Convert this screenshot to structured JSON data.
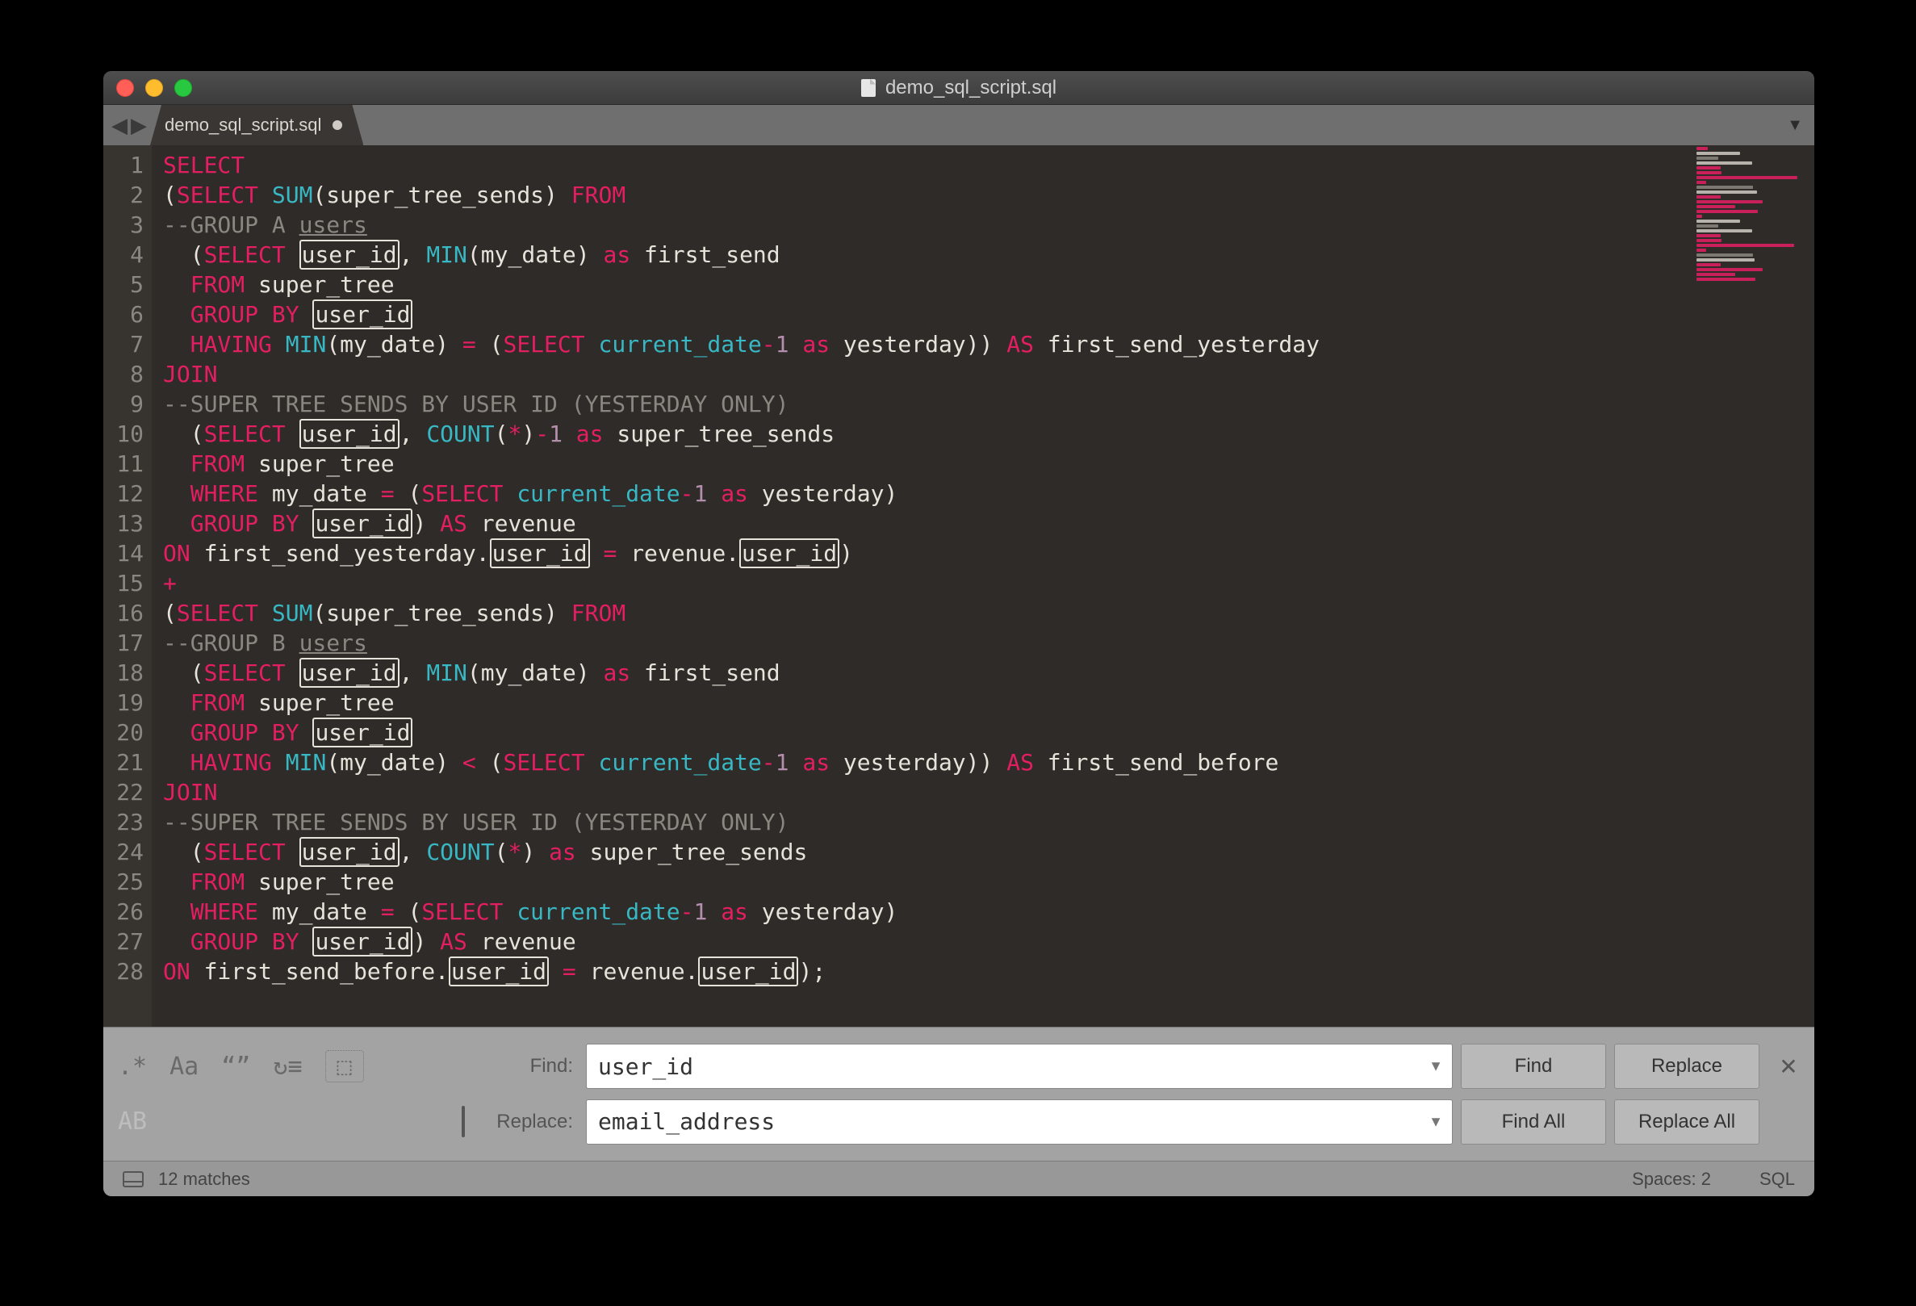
{
  "window": {
    "title": "demo_sql_script.sql"
  },
  "tabs": {
    "active": {
      "label": "demo_sql_script.sql",
      "dirty": true
    }
  },
  "code_lines": [
    [
      {
        "t": "SELECT",
        "c": "kw"
      }
    ],
    [
      {
        "t": "(",
        "c": "al"
      },
      {
        "t": "SELECT ",
        "c": "kw"
      },
      {
        "t": "SUM",
        "c": "fn"
      },
      {
        "t": "(super_tree_sends) ",
        "c": "al"
      },
      {
        "t": "FROM",
        "c": "kw"
      }
    ],
    [
      {
        "t": "--GROUP A ",
        "c": "cm"
      },
      {
        "t": "users",
        "c": "cm",
        "u": true
      }
    ],
    [
      {
        "t": "  (",
        "c": "al"
      },
      {
        "t": "SELECT ",
        "c": "kw"
      },
      {
        "t": "user_id",
        "c": "al",
        "hl": true
      },
      {
        "t": ", ",
        "c": "al"
      },
      {
        "t": "MIN",
        "c": "fn"
      },
      {
        "t": "(my_date) ",
        "c": "al"
      },
      {
        "t": "as",
        "c": "as"
      },
      {
        "t": " first_send",
        "c": "al"
      }
    ],
    [
      {
        "t": "  ",
        "c": "al"
      },
      {
        "t": "FROM",
        "c": "kw"
      },
      {
        "t": " super_tree",
        "c": "al"
      }
    ],
    [
      {
        "t": "  ",
        "c": "al"
      },
      {
        "t": "GROUP BY ",
        "c": "kw"
      },
      {
        "t": "user_id",
        "c": "al",
        "hl": true
      }
    ],
    [
      {
        "t": "  ",
        "c": "al"
      },
      {
        "t": "HAVING ",
        "c": "kw"
      },
      {
        "t": "MIN",
        "c": "fn"
      },
      {
        "t": "(my_date) ",
        "c": "al"
      },
      {
        "t": "= ",
        "c": "kw"
      },
      {
        "t": "(",
        "c": "al"
      },
      {
        "t": "SELECT ",
        "c": "kw"
      },
      {
        "t": "current_date",
        "c": "fn"
      },
      {
        "t": "-",
        "c": "kw"
      },
      {
        "t": "1",
        "c": "num"
      },
      {
        "t": " ",
        "c": "al"
      },
      {
        "t": "as",
        "c": "as"
      },
      {
        "t": " yesterday)) ",
        "c": "al"
      },
      {
        "t": "AS",
        "c": "kw"
      },
      {
        "t": " first_send_yesterday",
        "c": "al"
      }
    ],
    [
      {
        "t": "JOIN",
        "c": "kw"
      }
    ],
    [
      {
        "t": "--SUPER TREE SENDS BY USER ID (YESTERDAY ONLY)",
        "c": "cm"
      }
    ],
    [
      {
        "t": "  (",
        "c": "al"
      },
      {
        "t": "SELECT ",
        "c": "kw"
      },
      {
        "t": "user_id",
        "c": "al",
        "hl": true
      },
      {
        "t": ", ",
        "c": "al"
      },
      {
        "t": "COUNT",
        "c": "fn"
      },
      {
        "t": "(",
        "c": "al"
      },
      {
        "t": "*",
        "c": "kw"
      },
      {
        "t": ")",
        "c": "al"
      },
      {
        "t": "-",
        "c": "kw"
      },
      {
        "t": "1",
        "c": "num"
      },
      {
        "t": " ",
        "c": "al"
      },
      {
        "t": "as",
        "c": "as"
      },
      {
        "t": " super_tree_sends",
        "c": "al"
      }
    ],
    [
      {
        "t": "  ",
        "c": "al"
      },
      {
        "t": "FROM",
        "c": "kw"
      },
      {
        "t": " super_tree",
        "c": "al"
      }
    ],
    [
      {
        "t": "  ",
        "c": "al"
      },
      {
        "t": "WHERE",
        "c": "kw"
      },
      {
        "t": " my_date ",
        "c": "al"
      },
      {
        "t": "= ",
        "c": "kw"
      },
      {
        "t": "(",
        "c": "al"
      },
      {
        "t": "SELECT ",
        "c": "kw"
      },
      {
        "t": "current_date",
        "c": "fn"
      },
      {
        "t": "-",
        "c": "kw"
      },
      {
        "t": "1",
        "c": "num"
      },
      {
        "t": " ",
        "c": "al"
      },
      {
        "t": "as",
        "c": "as"
      },
      {
        "t": " yesterday)",
        "c": "al"
      }
    ],
    [
      {
        "t": "  ",
        "c": "al"
      },
      {
        "t": "GROUP BY ",
        "c": "kw"
      },
      {
        "t": "user_id",
        "c": "al",
        "hl": true
      },
      {
        "t": ") ",
        "c": "al"
      },
      {
        "t": "AS",
        "c": "kw"
      },
      {
        "t": " revenue",
        "c": "al"
      }
    ],
    [
      {
        "t": "ON",
        "c": "kw"
      },
      {
        "t": " first_send_yesterday.",
        "c": "al"
      },
      {
        "t": "user_id",
        "c": "al",
        "hl": true
      },
      {
        "t": " ",
        "c": "al"
      },
      {
        "t": "= ",
        "c": "kw"
      },
      {
        "t": "revenue.",
        "c": "al"
      },
      {
        "t": "user_id",
        "c": "al",
        "hl": true
      },
      {
        "t": ")",
        "c": "al"
      }
    ],
    [
      {
        "t": "+",
        "c": "kw"
      }
    ],
    [
      {
        "t": "(",
        "c": "al"
      },
      {
        "t": "SELECT ",
        "c": "kw"
      },
      {
        "t": "SUM",
        "c": "fn"
      },
      {
        "t": "(super_tree_sends) ",
        "c": "al"
      },
      {
        "t": "FROM",
        "c": "kw"
      }
    ],
    [
      {
        "t": "--GROUP B ",
        "c": "cm"
      },
      {
        "t": "users",
        "c": "cm",
        "u": true
      }
    ],
    [
      {
        "t": "  (",
        "c": "al"
      },
      {
        "t": "SELECT ",
        "c": "kw"
      },
      {
        "t": "user_id",
        "c": "al",
        "hl": true
      },
      {
        "t": ", ",
        "c": "al"
      },
      {
        "t": "MIN",
        "c": "fn"
      },
      {
        "t": "(my_date) ",
        "c": "al"
      },
      {
        "t": "as",
        "c": "as"
      },
      {
        "t": " first_send",
        "c": "al"
      }
    ],
    [
      {
        "t": "  ",
        "c": "al"
      },
      {
        "t": "FROM",
        "c": "kw"
      },
      {
        "t": " super_tree",
        "c": "al"
      }
    ],
    [
      {
        "t": "  ",
        "c": "al"
      },
      {
        "t": "GROUP BY ",
        "c": "kw"
      },
      {
        "t": "user_id",
        "c": "al",
        "hl": true
      }
    ],
    [
      {
        "t": "  ",
        "c": "al"
      },
      {
        "t": "HAVING ",
        "c": "kw"
      },
      {
        "t": "MIN",
        "c": "fn"
      },
      {
        "t": "(my_date) ",
        "c": "al"
      },
      {
        "t": "< ",
        "c": "kw"
      },
      {
        "t": "(",
        "c": "al"
      },
      {
        "t": "SELECT ",
        "c": "kw"
      },
      {
        "t": "current_date",
        "c": "fn"
      },
      {
        "t": "-",
        "c": "kw"
      },
      {
        "t": "1",
        "c": "num"
      },
      {
        "t": " ",
        "c": "al"
      },
      {
        "t": "as",
        "c": "as"
      },
      {
        "t": " yesterday)) ",
        "c": "al"
      },
      {
        "t": "AS",
        "c": "kw"
      },
      {
        "t": " first_send_before",
        "c": "al"
      }
    ],
    [
      {
        "t": "JOIN",
        "c": "kw"
      }
    ],
    [
      {
        "t": "--SUPER TREE SENDS BY USER ID (YESTERDAY ONLY)",
        "c": "cm"
      }
    ],
    [
      {
        "t": "  (",
        "c": "al"
      },
      {
        "t": "SELECT ",
        "c": "kw"
      },
      {
        "t": "user_id",
        "c": "al",
        "hl": true
      },
      {
        "t": ", ",
        "c": "al"
      },
      {
        "t": "COUNT",
        "c": "fn"
      },
      {
        "t": "(",
        "c": "al"
      },
      {
        "t": "*",
        "c": "kw"
      },
      {
        "t": ") ",
        "c": "al"
      },
      {
        "t": "as",
        "c": "as"
      },
      {
        "t": " super_tree_sends",
        "c": "al"
      }
    ],
    [
      {
        "t": "  ",
        "c": "al"
      },
      {
        "t": "FROM",
        "c": "kw"
      },
      {
        "t": " super_tree",
        "c": "al"
      }
    ],
    [
      {
        "t": "  ",
        "c": "al"
      },
      {
        "t": "WHERE",
        "c": "kw"
      },
      {
        "t": " my_date ",
        "c": "al"
      },
      {
        "t": "= ",
        "c": "kw"
      },
      {
        "t": "(",
        "c": "al"
      },
      {
        "t": "SELECT ",
        "c": "kw"
      },
      {
        "t": "current_date",
        "c": "fn"
      },
      {
        "t": "-",
        "c": "kw"
      },
      {
        "t": "1",
        "c": "num"
      },
      {
        "t": " ",
        "c": "al"
      },
      {
        "t": "as",
        "c": "as"
      },
      {
        "t": " yesterday)",
        "c": "al"
      }
    ],
    [
      {
        "t": "  ",
        "c": "al"
      },
      {
        "t": "GROUP BY ",
        "c": "kw"
      },
      {
        "t": "user_id",
        "c": "al",
        "hl": true
      },
      {
        "t": ") ",
        "c": "al"
      },
      {
        "t": "AS",
        "c": "kw"
      },
      {
        "t": " revenue",
        "c": "al"
      }
    ],
    [
      {
        "t": "ON",
        "c": "kw"
      },
      {
        "t": " first_send_before.",
        "c": "al"
      },
      {
        "t": "user_id",
        "c": "al",
        "hl": true
      },
      {
        "t": " ",
        "c": "al"
      },
      {
        "t": "= ",
        "c": "kw"
      },
      {
        "t": "revenue.",
        "c": "al"
      },
      {
        "t": "user_id",
        "c": "al",
        "hl": true
      },
      {
        "t": ");",
        "c": "al"
      }
    ]
  ],
  "find": {
    "options": {
      "regex": ".*",
      "case": "Aa",
      "whole": "“”",
      "wrap": "↻≡",
      "in_selection_icon": "▭",
      "preserve_case": "AB",
      "highlight_icon": "▭"
    },
    "find_label": "Find:",
    "replace_label": "Replace:",
    "find_value": "user_id",
    "replace_value": "email_address",
    "buttons": {
      "find": "Find",
      "replace": "Replace",
      "find_all": "Find All",
      "replace_all": "Replace All"
    }
  },
  "status": {
    "matches": "12 matches",
    "spaces": "Spaces: 2",
    "lang": "SQL"
  }
}
